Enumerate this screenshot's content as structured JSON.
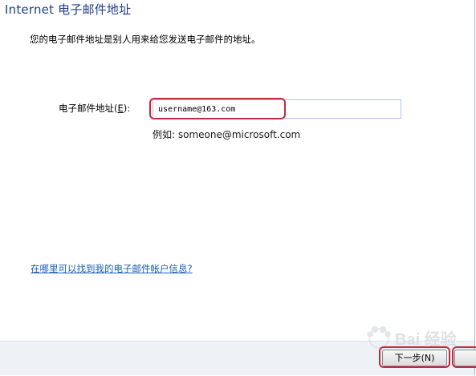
{
  "wizard": {
    "title": "Internet 电子邮件地址",
    "instruction": "您的电子邮件地址是别人用来给您发送电子邮件的地址。"
  },
  "email": {
    "label_prefix": "电子邮件地址(",
    "label_hotkey": "E",
    "label_suffix": "):",
    "value": "username@163.com",
    "example": "例如: someone@microsoft.com"
  },
  "help": {
    "link_text": "在哪里可以找到我的电子邮件帐户信息?"
  },
  "footer": {
    "next_label": "下一步(N)"
  },
  "watermark": {
    "text": "Bai 经验"
  },
  "colors": {
    "title": "#1e3f87",
    "link": "#1a5fb4",
    "highlight": "#c22b3c",
    "input_border": "#a8c6e6",
    "footer_bg": "#eef1f5"
  }
}
